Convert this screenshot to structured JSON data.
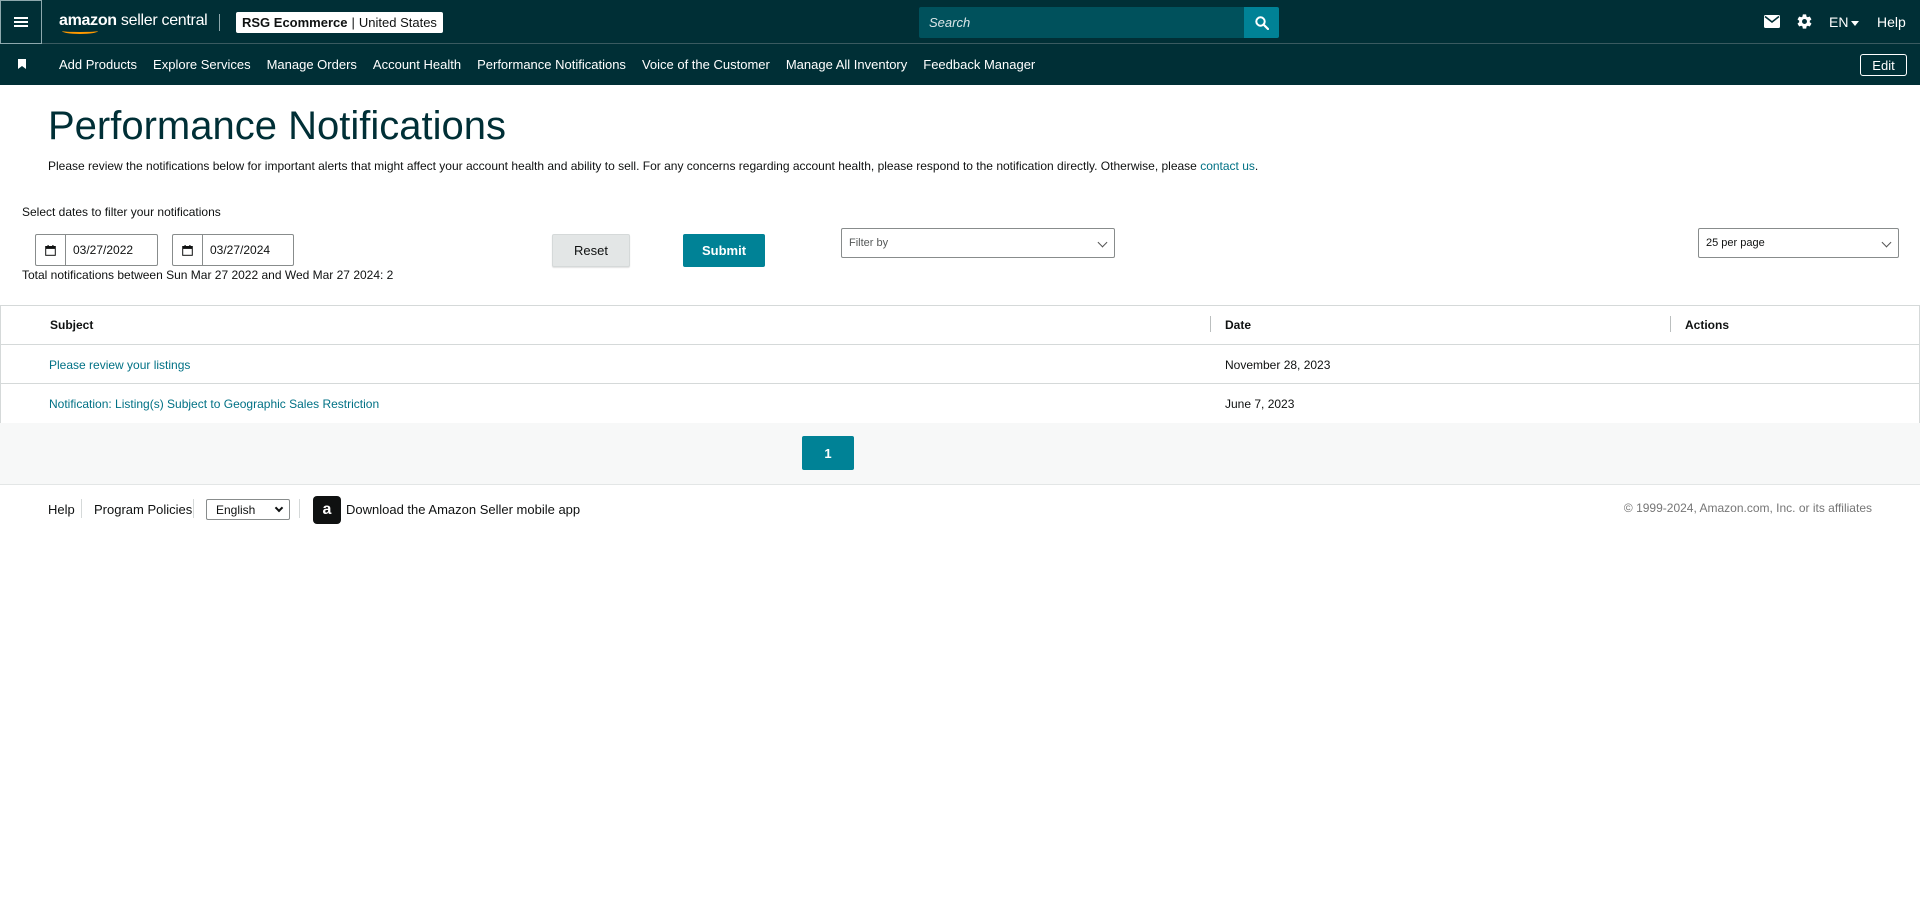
{
  "header": {
    "logo_main": "amazon",
    "logo_sub": " seller central",
    "account_name": "RSG Ecommerce",
    "account_sep": "|",
    "account_region": "United States",
    "search_placeholder": "Search",
    "language": "EN",
    "help": "Help"
  },
  "nav": {
    "items": [
      "Add Products",
      "Explore Services",
      "Manage Orders",
      "Account Health",
      "Performance Notifications",
      "Voice of the Customer",
      "Manage All Inventory",
      "Feedback Manager"
    ],
    "edit": "Edit"
  },
  "page": {
    "title": "Performance Notifications",
    "description": "Please review the notifications below for important alerts that might affect your account health and ability to sell. For any concerns regarding account health, please respond to the notification directly. Otherwise, please ",
    "contact_link": "contact us",
    "description_end": ".",
    "filter_label": "Select dates to filter your notifications",
    "start_date": "03/27/2022",
    "end_date": "03/27/2024",
    "reset": "Reset",
    "submit": "Submit",
    "filter_by": "Filter by",
    "per_page": "25 per page",
    "total": "Total notifications between Sun Mar 27 2022 and Wed Mar 27 2024: 2"
  },
  "table": {
    "headers": {
      "subject": "Subject",
      "date": "Date",
      "actions": "Actions"
    },
    "rows": [
      {
        "subject": "Please review your listings",
        "date": "November 28, 2023"
      },
      {
        "subject": "Notification: Listing(s) Subject to Geographic Sales Restriction",
        "date": "June 7, 2023"
      }
    ]
  },
  "pagination": {
    "current": "1"
  },
  "footer": {
    "help": "Help",
    "program_policies": "Program Policies",
    "language": "English",
    "app_text": "Download the Amazon Seller mobile app",
    "copyright": "© 1999-2024, Amazon.com, Inc. or its affiliates"
  },
  "colors": {
    "header_bg": "#002f36",
    "accent": "#008296",
    "link": "#007185"
  }
}
